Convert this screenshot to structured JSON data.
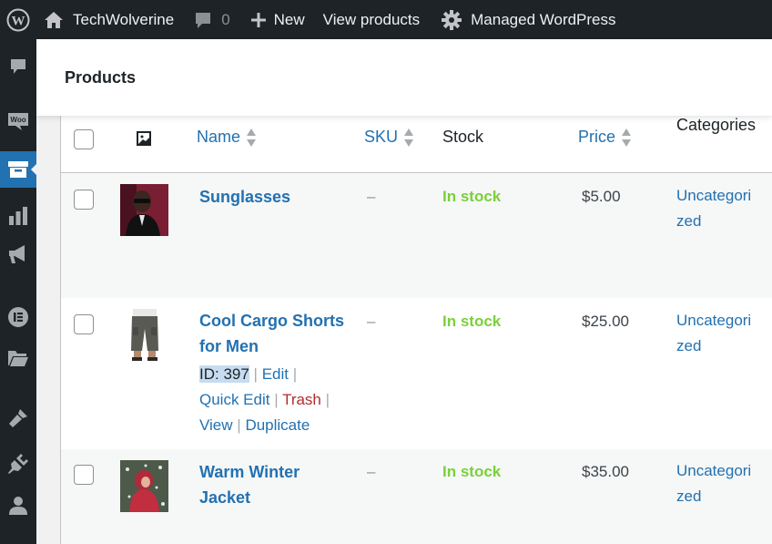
{
  "admin_bar": {
    "site_name": "TechWolverine",
    "comments_count": "0",
    "new_label": "New",
    "view_products_label": "View products",
    "managed_label": "Managed WordPress"
  },
  "side_menu": {
    "icons": [
      "comments-icon",
      "woocommerce-icon",
      "products-icon",
      "analytics-icon",
      "marketing-icon",
      "elementor-icon",
      "templates-icon",
      "appearance-icon",
      "plugins-icon",
      "users-icon"
    ],
    "active": "products-icon"
  },
  "page": {
    "title": "Products"
  },
  "table": {
    "columns": {
      "name": "Name",
      "sku": "SKU",
      "stock": "Stock",
      "price": "Price",
      "categories": "Categories"
    },
    "rows": [
      {
        "name": "Sunglasses",
        "sku": "–",
        "stock": "In stock",
        "price": "$5.00",
        "category": "Uncategorized"
      },
      {
        "name": "Cool Cargo Shorts for Men",
        "sku": "–",
        "stock": "In stock",
        "price": "$25.00",
        "category": "Uncategorized",
        "row_actions": {
          "id": "ID: 397",
          "edit": "Edit",
          "quick_edit": "Quick Edit",
          "trash": "Trash",
          "view": "View",
          "duplicate": "Duplicate",
          "separator": "|"
        }
      },
      {
        "name": "Warm Winter Jacket",
        "sku": "–",
        "stock": "In stock",
        "price": "$35.00",
        "category": "Uncategorized"
      }
    ]
  },
  "colors": {
    "admin_bar_bg": "#1d2327",
    "accent": "#2271b1",
    "in_stock": "#7ad03a",
    "trash": "#b32d2e",
    "header_bg": "#ffffff"
  }
}
